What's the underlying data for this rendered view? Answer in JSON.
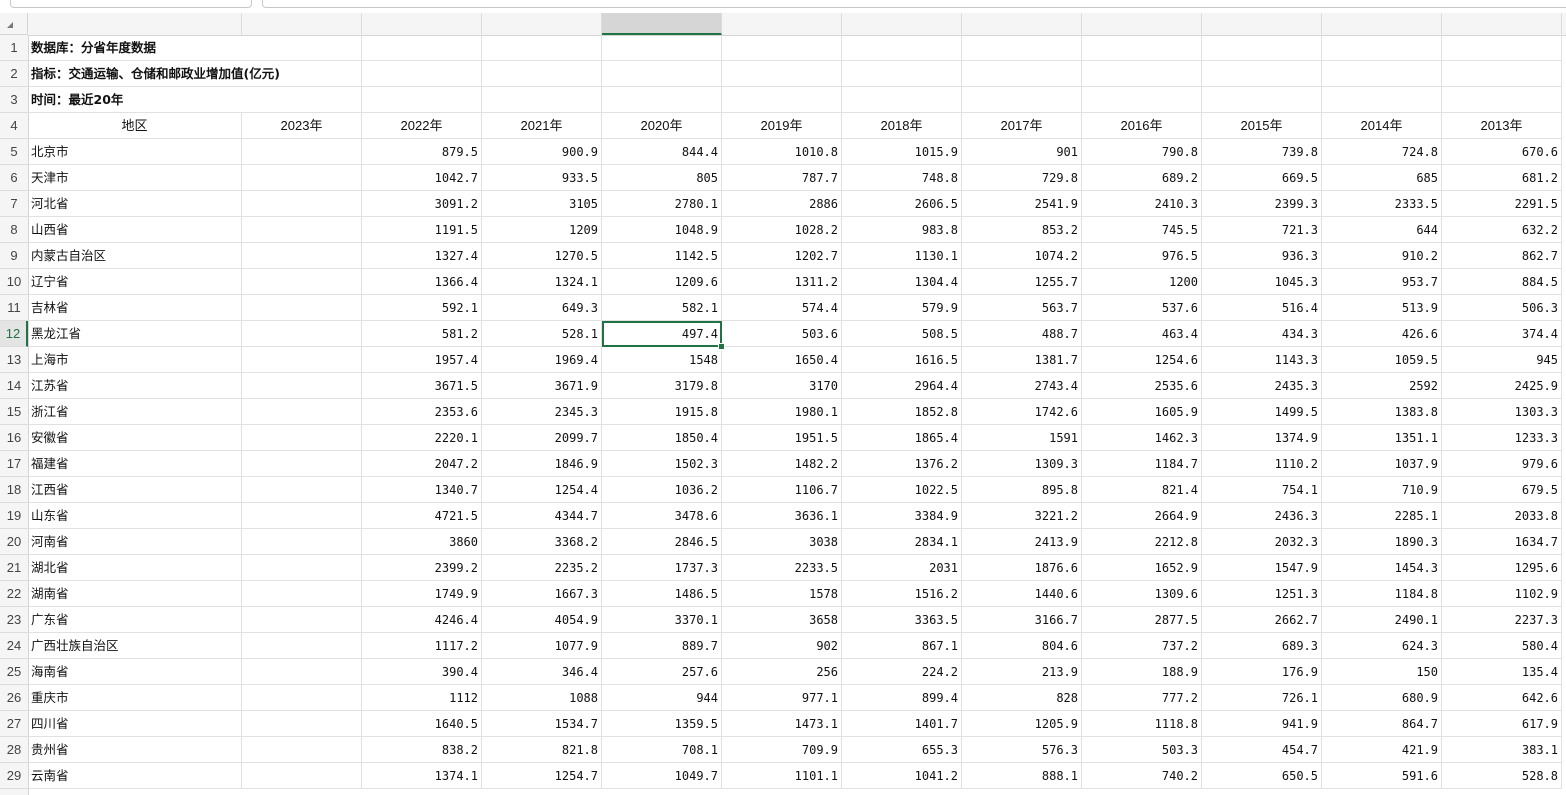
{
  "columns": [
    "A",
    "B",
    "C",
    "D",
    "E",
    "F",
    "G",
    "H",
    "I",
    "J",
    "K",
    "L"
  ],
  "active_column": "E",
  "active_row": 12,
  "info_rows": [
    "数据库：分省年度数据",
    "指标：交通运输、仓储和邮政业增加值(亿元)",
    "时间：最近20年"
  ],
  "header_row": [
    "地区",
    "2023年",
    "2022年",
    "2021年",
    "2020年",
    "2019年",
    "2018年",
    "2017年",
    "2016年",
    "2015年",
    "2014年",
    "2013年"
  ],
  "data_rows": [
    [
      "北京市",
      "",
      "879.5",
      "900.9",
      "844.4",
      "1010.8",
      "1015.9",
      "901",
      "790.8",
      "739.8",
      "724.8",
      "670.6"
    ],
    [
      "天津市",
      "",
      "1042.7",
      "933.5",
      "805",
      "787.7",
      "748.8",
      "729.8",
      "689.2",
      "669.5",
      "685",
      "681.2"
    ],
    [
      "河北省",
      "",
      "3091.2",
      "3105",
      "2780.1",
      "2886",
      "2606.5",
      "2541.9",
      "2410.3",
      "2399.3",
      "2333.5",
      "2291.5"
    ],
    [
      "山西省",
      "",
      "1191.5",
      "1209",
      "1048.9",
      "1028.2",
      "983.8",
      "853.2",
      "745.5",
      "721.3",
      "644",
      "632.2"
    ],
    [
      "内蒙古自治区",
      "",
      "1327.4",
      "1270.5",
      "1142.5",
      "1202.7",
      "1130.1",
      "1074.2",
      "976.5",
      "936.3",
      "910.2",
      "862.7"
    ],
    [
      "辽宁省",
      "",
      "1366.4",
      "1324.1",
      "1209.6",
      "1311.2",
      "1304.4",
      "1255.7",
      "1200",
      "1045.3",
      "953.7",
      "884.5"
    ],
    [
      "吉林省",
      "",
      "592.1",
      "649.3",
      "582.1",
      "574.4",
      "579.9",
      "563.7",
      "537.6",
      "516.4",
      "513.9",
      "506.3"
    ],
    [
      "黑龙江省",
      "",
      "581.2",
      "528.1",
      "497.4",
      "503.6",
      "508.5",
      "488.7",
      "463.4",
      "434.3",
      "426.6",
      "374.4"
    ],
    [
      "上海市",
      "",
      "1957.4",
      "1969.4",
      "1548",
      "1650.4",
      "1616.5",
      "1381.7",
      "1254.6",
      "1143.3",
      "1059.5",
      "945"
    ],
    [
      "江苏省",
      "",
      "3671.5",
      "3671.9",
      "3179.8",
      "3170",
      "2964.4",
      "2743.4",
      "2535.6",
      "2435.3",
      "2592",
      "2425.9"
    ],
    [
      "浙江省",
      "",
      "2353.6",
      "2345.3",
      "1915.8",
      "1980.1",
      "1852.8",
      "1742.6",
      "1605.9",
      "1499.5",
      "1383.8",
      "1303.3"
    ],
    [
      "安徽省",
      "",
      "2220.1",
      "2099.7",
      "1850.4",
      "1951.5",
      "1865.4",
      "1591",
      "1462.3",
      "1374.9",
      "1351.1",
      "1233.3"
    ],
    [
      "福建省",
      "",
      "2047.2",
      "1846.9",
      "1502.3",
      "1482.2",
      "1376.2",
      "1309.3",
      "1184.7",
      "1110.2",
      "1037.9",
      "979.6"
    ],
    [
      "江西省",
      "",
      "1340.7",
      "1254.4",
      "1036.2",
      "1106.7",
      "1022.5",
      "895.8",
      "821.4",
      "754.1",
      "710.9",
      "679.5"
    ],
    [
      "山东省",
      "",
      "4721.5",
      "4344.7",
      "3478.6",
      "3636.1",
      "3384.9",
      "3221.2",
      "2664.9",
      "2436.3",
      "2285.1",
      "2033.8"
    ],
    [
      "河南省",
      "",
      "3860",
      "3368.2",
      "2846.5",
      "3038",
      "2834.1",
      "2413.9",
      "2212.8",
      "2032.3",
      "1890.3",
      "1634.7"
    ],
    [
      "湖北省",
      "",
      "2399.2",
      "2235.2",
      "1737.3",
      "2233.5",
      "2031",
      "1876.6",
      "1652.9",
      "1547.9",
      "1454.3",
      "1295.6"
    ],
    [
      "湖南省",
      "",
      "1749.9",
      "1667.3",
      "1486.5",
      "1578",
      "1516.2",
      "1440.6",
      "1309.6",
      "1251.3",
      "1184.8",
      "1102.9"
    ],
    [
      "广东省",
      "",
      "4246.4",
      "4054.9",
      "3370.1",
      "3658",
      "3363.5",
      "3166.7",
      "2877.5",
      "2662.7",
      "2490.1",
      "2237.3"
    ],
    [
      "广西壮族自治区",
      "",
      "1117.2",
      "1077.9",
      "889.7",
      "902",
      "867.1",
      "804.6",
      "737.2",
      "689.3",
      "624.3",
      "580.4"
    ],
    [
      "海南省",
      "",
      "390.4",
      "346.4",
      "257.6",
      "256",
      "224.2",
      "213.9",
      "188.9",
      "176.9",
      "150",
      "135.4"
    ],
    [
      "重庆市",
      "",
      "1112",
      "1088",
      "944",
      "977.1",
      "899.4",
      "828",
      "777.2",
      "726.1",
      "680.9",
      "642.6"
    ],
    [
      "四川省",
      "",
      "1640.5",
      "1534.7",
      "1359.5",
      "1473.1",
      "1401.7",
      "1205.9",
      "1118.8",
      "941.9",
      "864.7",
      "617.9"
    ],
    [
      "贵州省",
      "",
      "838.2",
      "821.8",
      "708.1",
      "709.9",
      "655.3",
      "576.3",
      "503.3",
      "454.7",
      "421.9",
      "383.1"
    ],
    [
      "云南省",
      "",
      "1374.1",
      "1254.7",
      "1049.7",
      "1101.1",
      "1041.2",
      "888.1",
      "740.2",
      "650.5",
      "591.6",
      "528.8"
    ]
  ]
}
